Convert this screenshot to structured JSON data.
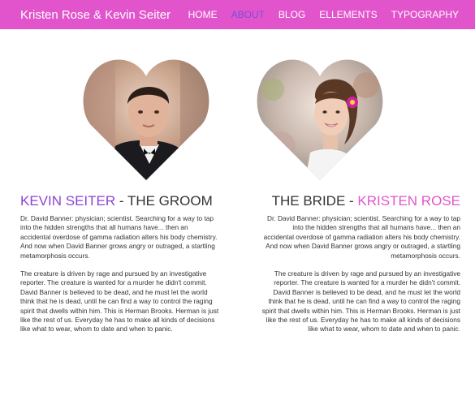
{
  "brand": {
    "title": "Kristen Rose & Kevin Seiter"
  },
  "nav": {
    "items": [
      "HOME",
      "ABOUT",
      "BLOG",
      "ELLEMENTS",
      "TYPOGRAPHY"
    ],
    "active": "ABOUT"
  },
  "groom": {
    "name": "KEVIN SEITER",
    "separator": " - ",
    "role": "THE GROOM",
    "photo_alt": "groom-photo",
    "paragraphs": [
      "Dr. David Banner: physician; scientist. Searching for a way to tap into the hidden strengths that all humans have... then an accidental overdose of gamma radiation alters his body chemistry. And now when David Banner grows angry or outraged, a startling metamorphosis occurs.",
      "The creature is driven by rage and pursued by an investigative reporter. The creature is wanted for a murder he didn't commit. David Banner is believed to be dead, and he must let the world think that he is dead, until he can find a way to control the raging spirit that dwells within him. This is Herman Brooks. Herman is just like the rest of us. Everyday he has to make all kinds of decisions like what to wear, whom to date and when to panic."
    ]
  },
  "bride": {
    "role": "THE BRIDE",
    "separator": " - ",
    "name": "KRISTEN ROSE",
    "paragraphs": [
      "Dr. David Banner: physician; scientist. Searching for a way to tap into the hidden strengths that all humans have... then an accidental overdose of gamma radiation alters his body chemistry. And now when David Banner grows angry or outraged, a startling metamorphosis occurs.",
      "The creature is driven by rage and pursued by an investigative reporter. The creature is wanted for a murder he didn't commit. David Banner is believed to be dead, and he must let the world think that he is dead, until he can find a way to control the raging spirit that dwells within him. This is Herman Brooks. Herman is just like the rest of us. Everyday he has to make all kinds of decisions like what to wear, whom to date and when to panic."
    ]
  },
  "colors": {
    "topbar": "#e254cc",
    "groom_accent": "#8b44d4",
    "bride_accent": "#e254cc",
    "nav_active": "#7b4fd6"
  }
}
